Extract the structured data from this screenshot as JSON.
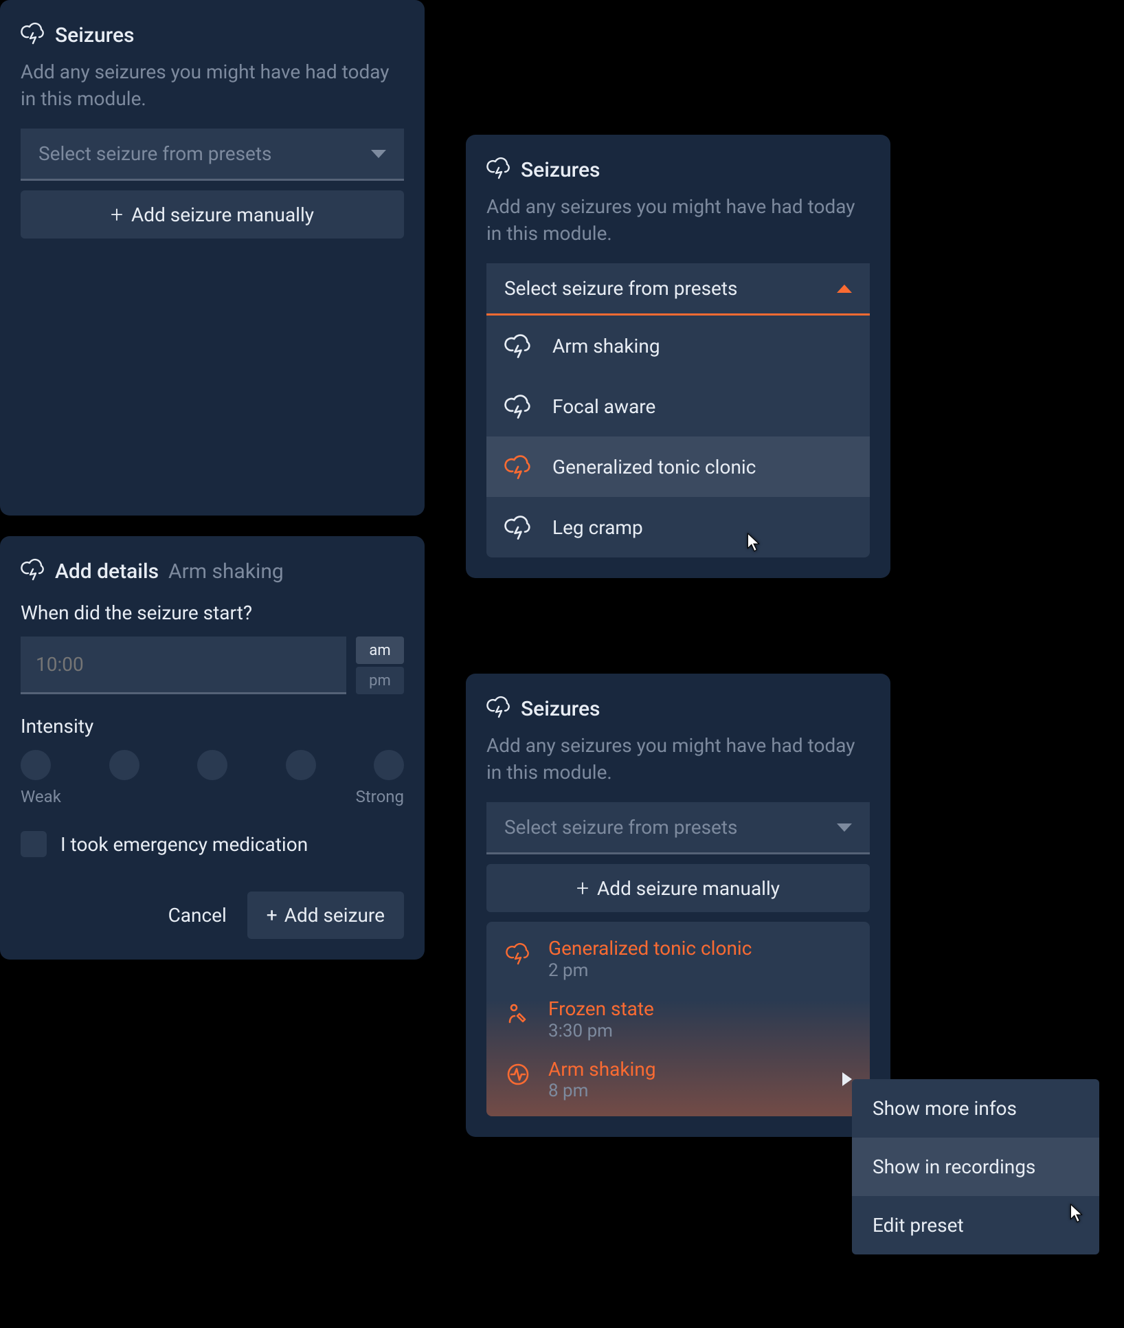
{
  "colors": {
    "accent": "#FA6B32",
    "panel": "#19283E",
    "text": "#E8EDF4"
  },
  "seizures_module": {
    "title": "Seizures",
    "subtitle": "Add any seizures you might have had today in this module.",
    "select_placeholder": "Select seizure from presets",
    "add_manual_label": "Add seizure manually"
  },
  "presets": [
    {
      "label": "Arm shaking",
      "icon": "cloud-bolt"
    },
    {
      "label": "Focal aware",
      "icon": "cloud-bolt"
    },
    {
      "label": "Generalized tonic clonic",
      "icon": "cloud-bolt",
      "active": true
    },
    {
      "label": "Leg cramp",
      "icon": "cloud-bolt"
    }
  ],
  "details": {
    "title": "Add details",
    "subject": "Arm shaking",
    "time_question": "When did the seizure start?",
    "time_placeholder": "10:00",
    "am": "am",
    "pm": "pm",
    "intensity_label": "Intensity",
    "intensity_weak": "Weak",
    "intensity_strong": "Strong",
    "emergency_label": "I took emergency medication",
    "cancel": "Cancel",
    "add": "Add seizure"
  },
  "entries": [
    {
      "name": "Generalized tonic clonic",
      "time": "2 pm",
      "icon": "cloud-bolt"
    },
    {
      "name": "Frozen state",
      "time": "3:30 pm",
      "icon": "edit-figure"
    },
    {
      "name": "Arm shaking",
      "time": "8 pm",
      "icon": "activity",
      "caret": true
    }
  ],
  "context_menu": {
    "items": [
      {
        "label": "Show more infos"
      },
      {
        "label": "Show in recordings",
        "hover": true
      },
      {
        "label": "Edit preset"
      }
    ]
  }
}
